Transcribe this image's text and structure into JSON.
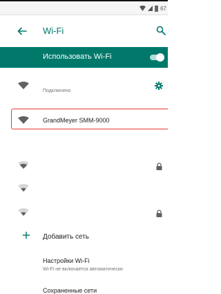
{
  "status_bar": {
    "battery": "67"
  },
  "toolbar": {
    "title": "Wi-Fi"
  },
  "master_switch": {
    "label": "Использовать Wi-Fi",
    "on": true,
    "accent": "#00796b"
  },
  "networks": [
    {
      "name": "",
      "status": "Подключено",
      "connected": true,
      "secured": false,
      "icon": "wifi-strong-icon"
    },
    {
      "name": "",
      "secured": true,
      "icon": "wifi-strong-icon"
    },
    {
      "name": "GrandMeyer SMM-9000",
      "secured": false,
      "selected": true,
      "icon": "wifi-strong-icon"
    },
    {
      "name": "",
      "secured": true,
      "icon": "wifi-medium-icon"
    },
    {
      "name": "",
      "secured": false,
      "icon": "wifi-weak-icon"
    },
    {
      "name": "",
      "secured": true,
      "icon": "wifi-weak-icon"
    }
  ],
  "add_network": {
    "label": "Добавить сеть"
  },
  "wifi_settings": {
    "title": "Настройки Wi-Fi",
    "subtitle": "Wi-Fi не включается автоматически"
  },
  "saved_networks": {
    "label": "Сохраненные сети"
  },
  "colors": {
    "accent": "#00796b",
    "selection_border": "#e53935"
  }
}
